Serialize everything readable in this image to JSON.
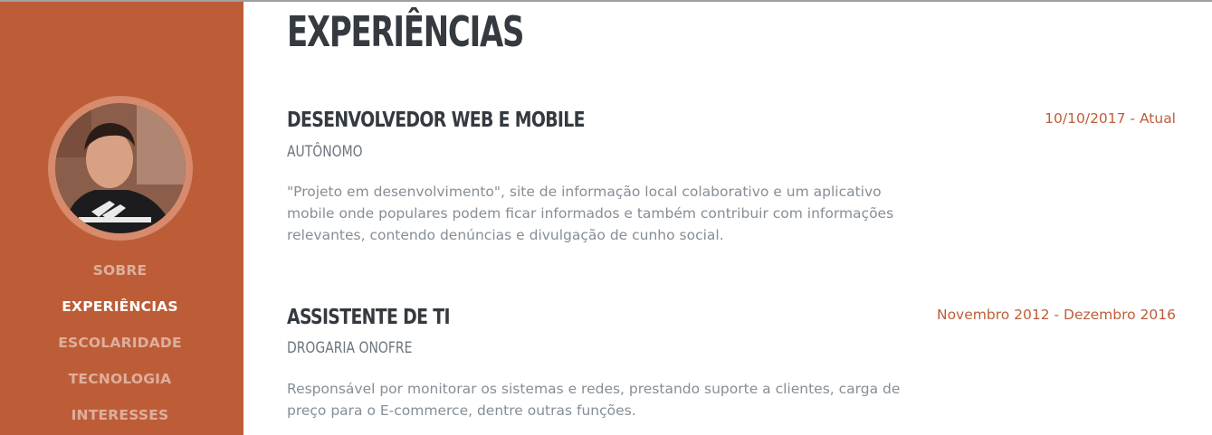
{
  "sidebar": {
    "nav": [
      {
        "label": "SOBRE",
        "active": false
      },
      {
        "label": "EXPERIÊNCIAS",
        "active": true
      },
      {
        "label": "ESCOLARIDADE",
        "active": false
      },
      {
        "label": "TECNOLOGIA",
        "active": false
      },
      {
        "label": "INTERESSES",
        "active": false
      }
    ],
    "accent_color": "#bd5d38"
  },
  "main": {
    "title": "EXPERIÊNCIAS",
    "jobs": [
      {
        "title": "DESENVOLVEDOR WEB E MOBILE",
        "company": "AUTÔNOMO",
        "description": "\"Projeto em desenvolvimento\", site de informação local colaborativo e um aplicativo mobile onde populares podem ficar informados e também contribuir com informações relevantes, contendo denúncias e divulgação de cunho social.",
        "date": "10/10/2017 - Atual"
      },
      {
        "title": "ASSISTENTE DE TI",
        "company": "DROGARIA ONOFRE",
        "description": "Responsável por monitorar os sistemas e redes, prestando suporte a clientes, carga de preço para o E-commerce, dentre outras funções.",
        "date": "Novembro 2012 - Dezembro 2016"
      }
    ]
  }
}
